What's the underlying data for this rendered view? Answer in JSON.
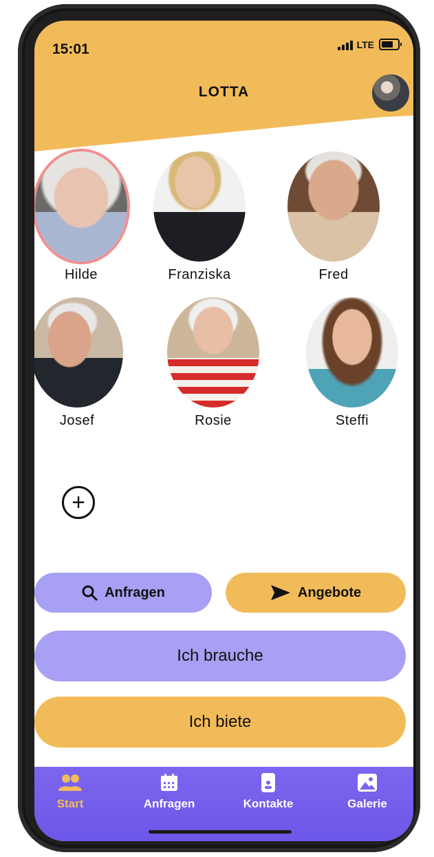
{
  "status": {
    "time": "15:01",
    "network": "LTE"
  },
  "header": {
    "title": "LOTTA"
  },
  "contacts": [
    {
      "name": "Hilde"
    },
    {
      "name": "Franziska"
    },
    {
      "name": "Fred"
    },
    {
      "name": "Josef"
    },
    {
      "name": "Rosie"
    },
    {
      "name": "Steffi"
    }
  ],
  "actions": {
    "requests_label": "Anfragen",
    "offers_label": "Angebote",
    "need_label": "Ich brauche",
    "offer_label": "Ich biete"
  },
  "nav": {
    "items": [
      {
        "label": "Start",
        "icon": "people-icon"
      },
      {
        "label": "Anfragen",
        "icon": "calendar-icon"
      },
      {
        "label": "Kontakte",
        "icon": "phone-contact-icon"
      },
      {
        "label": "Galerie",
        "icon": "image-icon"
      }
    ]
  },
  "colors": {
    "accent_orange": "#f2bb5a",
    "accent_purple": "#a8a0f4",
    "nav_purple": "#7c66ef",
    "selected_ring": "#ef8f8f"
  }
}
